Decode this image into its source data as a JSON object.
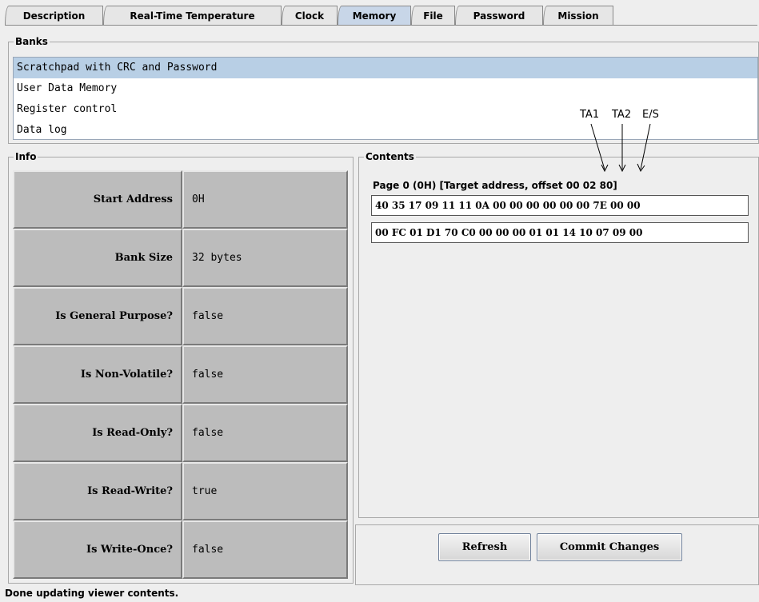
{
  "tabs": [
    {
      "label": "Description"
    },
    {
      "label": "Real-Time Temperature"
    },
    {
      "label": "Clock"
    },
    {
      "label": "Memory"
    },
    {
      "label": "File"
    },
    {
      "label": "Password"
    },
    {
      "label": "Mission"
    }
  ],
  "banks": {
    "title": "Banks",
    "items": [
      "Scratchpad with CRC and Password",
      "User Data Memory",
      "Register control",
      "Data log"
    ]
  },
  "info": {
    "title": "Info",
    "rows": [
      {
        "label": "Start Address",
        "value": "0H"
      },
      {
        "label": "Bank Size",
        "value": "32 bytes"
      },
      {
        "label": "Is General Purpose?",
        "value": "false"
      },
      {
        "label": "Is Non-Volatile?",
        "value": "false"
      },
      {
        "label": "Is Read-Only?",
        "value": "false"
      },
      {
        "label": "Is Read-Write?",
        "value": "true"
      },
      {
        "label": "Is Write-Once?",
        "value": "false"
      }
    ]
  },
  "contents": {
    "title": "Contents",
    "page_title": "Page 0 (0H) [Target address, offset 00 02 80]",
    "rows": [
      "40 35 17 09 11 11 0A 00 00 00 00 00 00 7E 00 00",
      "00 FC 01 D1 70 C0 00 00 00 01 01 14 10 07 09 00"
    ]
  },
  "annotations": {
    "ta1": "TA1",
    "ta2": "TA2",
    "es": "E/S"
  },
  "buttons": {
    "refresh": "Refresh",
    "commit": "Commit Changes"
  },
  "status": "Done updating viewer contents."
}
